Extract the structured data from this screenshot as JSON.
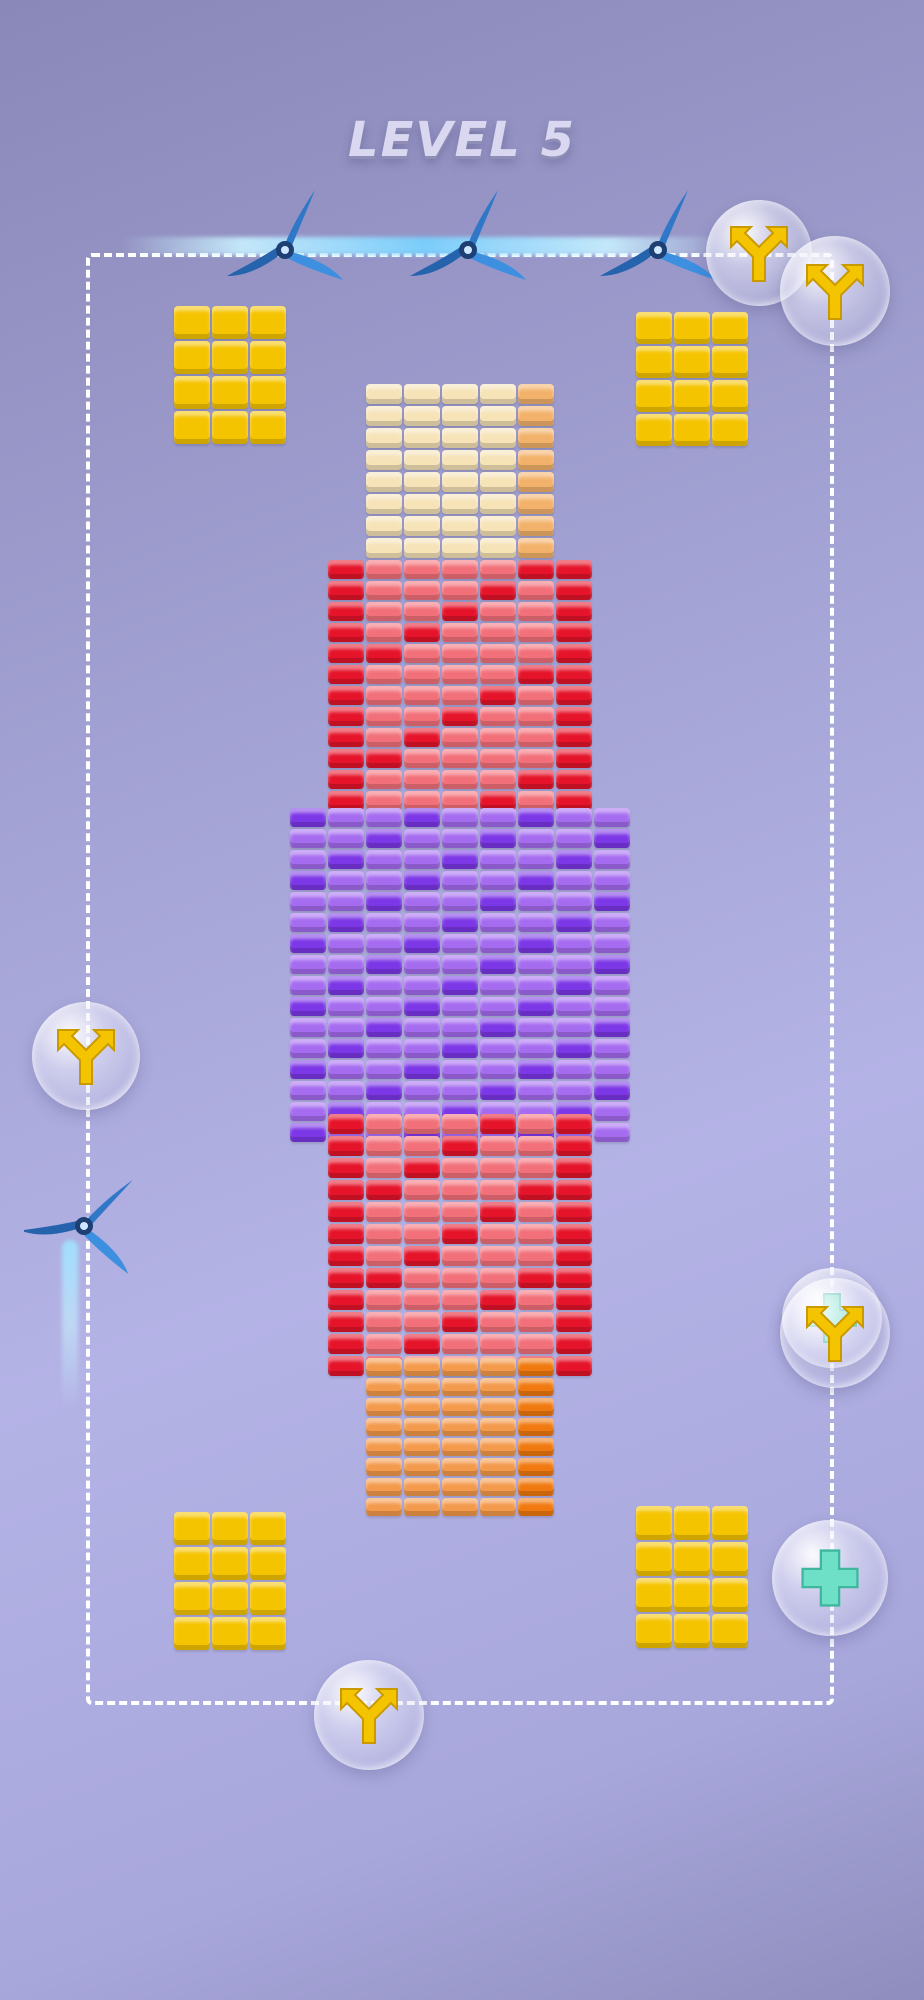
{
  "level": {
    "title": "LEVEL 5"
  },
  "colors": {
    "yellow": "#f5c400",
    "cream": "#f6e3b8",
    "peach": "#f3b26b",
    "pink": "#f2707a",
    "red": "#e5142a",
    "purple_light": "#a56cf0",
    "purple": "#7c37e6",
    "orange": "#f39a4c",
    "orange_dark": "#f07a10",
    "teal_plus": "#6fe0c8",
    "propeller": "#2f78c8"
  },
  "icons": {
    "propeller": "propeller-icon",
    "split_arrow": "split-arrow-icon",
    "plus": "plus-icon"
  },
  "pieces": {
    "yellow_blocks": 4,
    "propellers_on_top_rail": 3,
    "propellers_on_left_rail": 1,
    "split_bubbles": 5,
    "plus_bubbles": 2
  }
}
